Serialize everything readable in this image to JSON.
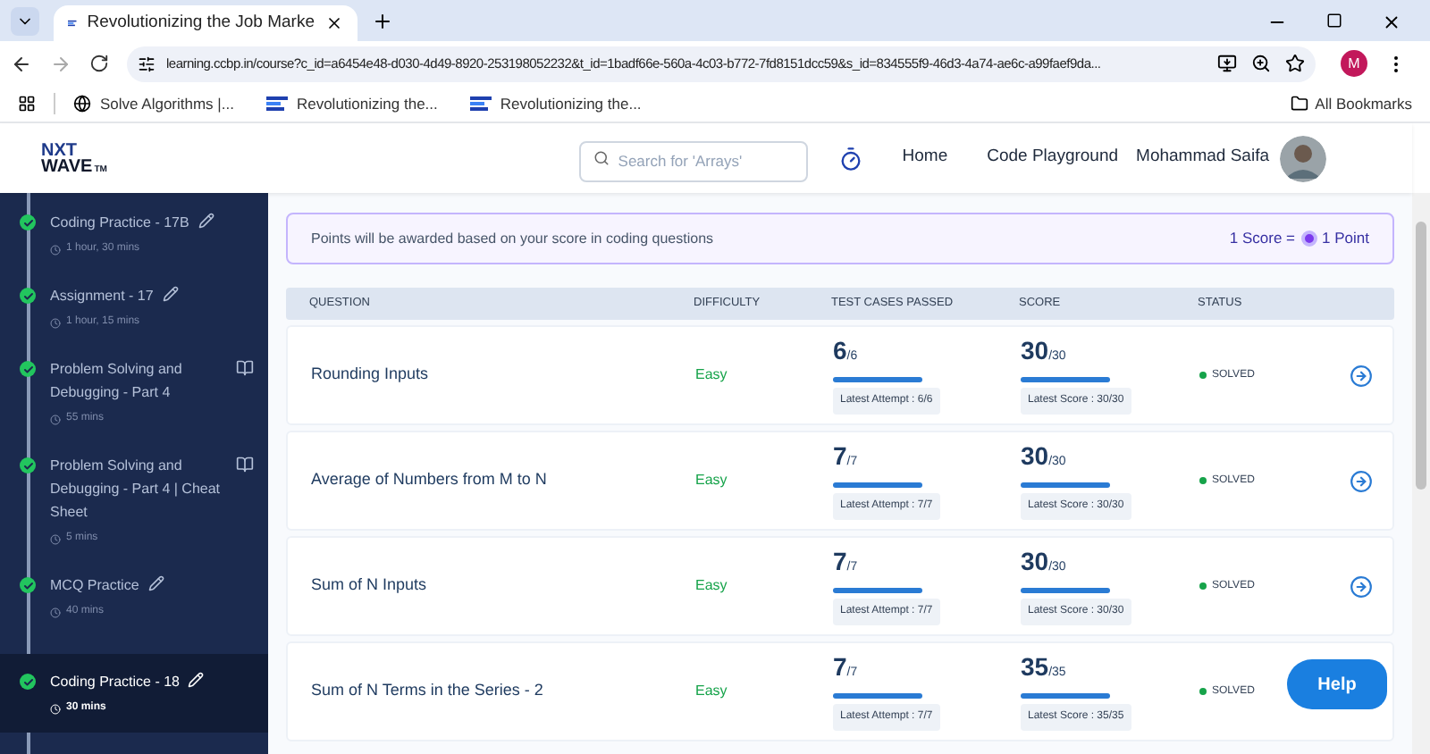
{
  "browser": {
    "tab_title": "Revolutionizing the Job Marke",
    "url": "learning.ccbp.in/course?c_id=a6454e48-d030-4d49-8920-253198052232&t_id=1badf66e-560a-4c03-b772-7fd8151dcc59&s_id=834555f9-46d3-4a74-ae6c-a99faef9da...",
    "profile_initial": "M",
    "bookmarks": [
      "Solve Algorithms |...",
      "Revolutionizing the...",
      "Revolutionizing the..."
    ],
    "all_bookmarks": "All Bookmarks"
  },
  "header": {
    "logo_top": "NXT",
    "logo_bottom": "WAVE",
    "logo_mark": "TM",
    "search": {
      "placeholder": "Search for 'Arrays'"
    },
    "nav": [
      "Home",
      "Code Playground"
    ],
    "user_name": "Mohammad Saifa"
  },
  "sidebar": {
    "items": [
      {
        "kind": "practice",
        "title": "Coding Practice - 17B",
        "duration": "1 hour, 30 mins",
        "selected": false
      },
      {
        "kind": "practice",
        "title": "Assignment - 17",
        "duration": "1 hour, 15 mins",
        "selected": false
      },
      {
        "kind": "reading",
        "title": "Problem Solving and Debugging - Part 4",
        "duration": "55 mins",
        "selected": false
      },
      {
        "kind": "reading",
        "title": "Problem Solving and Debugging - Part 4 | Cheat Sheet",
        "duration": "5 mins",
        "selected": false
      },
      {
        "kind": "practice",
        "title": "MCQ Practice",
        "duration": "40 mins",
        "selected": false
      },
      {
        "kind": "practice",
        "title": "Coding Practice - 18",
        "duration": "30 mins",
        "selected": true
      }
    ]
  },
  "banner": {
    "text": "Points will be awarded based on your score in coding questions",
    "score_label": "1 Score =",
    "point_label": "1 Point"
  },
  "table": {
    "columns": [
      "QUESTION",
      "DIFFICULTY",
      "TEST CASES PASSED",
      "SCORE",
      "STATUS"
    ],
    "rows": [
      {
        "question": "Rounding Inputs",
        "difficulty": "Easy",
        "passed": "6",
        "passed_total": "/6",
        "attempt": "Latest Attempt : 6/6",
        "score": "30",
        "score_total": "/30",
        "latest_score": "Latest Score : 30/30",
        "status": "SOLVED"
      },
      {
        "question": "Average of Numbers from M to N",
        "difficulty": "Easy",
        "passed": "7",
        "passed_total": "/7",
        "attempt": "Latest Attempt : 7/7",
        "score": "30",
        "score_total": "/30",
        "latest_score": "Latest Score : 30/30",
        "status": "SOLVED"
      },
      {
        "question": "Sum of N Inputs",
        "difficulty": "Easy",
        "passed": "7",
        "passed_total": "/7",
        "attempt": "Latest Attempt : 7/7",
        "score": "30",
        "score_total": "/30",
        "latest_score": "Latest Score : 30/30",
        "status": "SOLVED"
      },
      {
        "question": "Sum of N Terms in the Series - 2",
        "difficulty": "Easy",
        "passed": "7",
        "passed_total": "/7",
        "attempt": "Latest Attempt : 7/7",
        "score": "35",
        "score_total": "/35",
        "latest_score": "Latest Score : 35/35",
        "status": "SOLVED"
      }
    ]
  },
  "help_button": "Help"
}
